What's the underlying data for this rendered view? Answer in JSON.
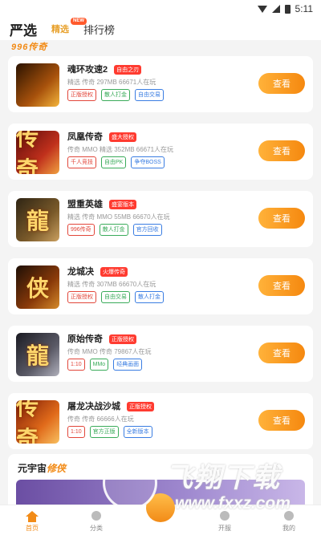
{
  "statusbar": {
    "time": "5:11"
  },
  "header": {
    "title": "严选",
    "tab_featured": "精选",
    "tab_featured_badge": "NEW",
    "tab_rank": "排行榜"
  },
  "section_logo": "996传奇",
  "games": [
    {
      "name": "魂环攻速2",
      "badge": "自由之刃",
      "meta": "精选 传奇 297MB 66671人在玩",
      "thumb_glyph": "",
      "tags": [
        {
          "text": "正版授权",
          "color": "red"
        },
        {
          "text": "散人打金",
          "color": "green"
        },
        {
          "text": "自由交易",
          "color": "blue"
        }
      ],
      "button": "查看"
    },
    {
      "name": "凤凰传奇",
      "badge": "盛大授权",
      "meta": "传奇 MMO 精选 352MB 66671人在玩",
      "thumb_glyph": "传奇",
      "tags": [
        {
          "text": "千人竞技",
          "color": "red"
        },
        {
          "text": "自由PK",
          "color": "green"
        },
        {
          "text": "争夺BOSS",
          "color": "blue"
        }
      ],
      "button": "查看"
    },
    {
      "name": "盟重英雄",
      "badge": "盛宴版本",
      "meta": "精选 传奇 MMO 55MB 66670人在玩",
      "thumb_glyph": "龍",
      "tags": [
        {
          "text": "996传奇",
          "color": "red"
        },
        {
          "text": "散人打金",
          "color": "green"
        },
        {
          "text": "官方回收",
          "color": "blue"
        }
      ],
      "button": "查看"
    },
    {
      "name": "龙城决",
      "badge": "火爆传奇",
      "meta": "精选 传奇 307MB 66670人在玩",
      "thumb_glyph": "侠",
      "tags": [
        {
          "text": "正版授权",
          "color": "red"
        },
        {
          "text": "自由交易",
          "color": "green"
        },
        {
          "text": "散人打金",
          "color": "blue"
        }
      ],
      "button": "查看"
    },
    {
      "name": "原始传奇",
      "badge": "正版授权",
      "meta": "传奇 MMO 传奇 79867人在玩",
      "thumb_glyph": "龍",
      "tags": [
        {
          "text": "1:10",
          "color": "red"
        },
        {
          "text": "MMo",
          "color": "green"
        },
        {
          "text": "经典画面",
          "color": "blue"
        }
      ],
      "button": "查看"
    },
    {
      "name": "屠龙决战沙城",
      "badge": "正版授权",
      "meta": "传奇 传奇 66666人在玩",
      "thumb_glyph": "传奇",
      "tags": [
        {
          "text": "1:10",
          "color": "red"
        },
        {
          "text": "官方正版",
          "color": "green"
        },
        {
          "text": "全新版本",
          "color": "blue"
        }
      ],
      "button": "查看"
    }
  ],
  "promo": {
    "title_prefix": "元宇宙",
    "title_accent": "修侠"
  },
  "watermark": {
    "text": "飞翔下载",
    "url": "www.fxxz.com"
  },
  "bottom_nav": [
    {
      "label": "首页",
      "active": true
    },
    {
      "label": "分类",
      "active": false
    },
    {
      "label": "开服",
      "active": false
    },
    {
      "label": "我的",
      "active": false
    }
  ],
  "colors": {
    "accent": "#f28b17",
    "button_gradient_start": "#ffb23a",
    "button_gradient_end": "#f5880f"
  }
}
